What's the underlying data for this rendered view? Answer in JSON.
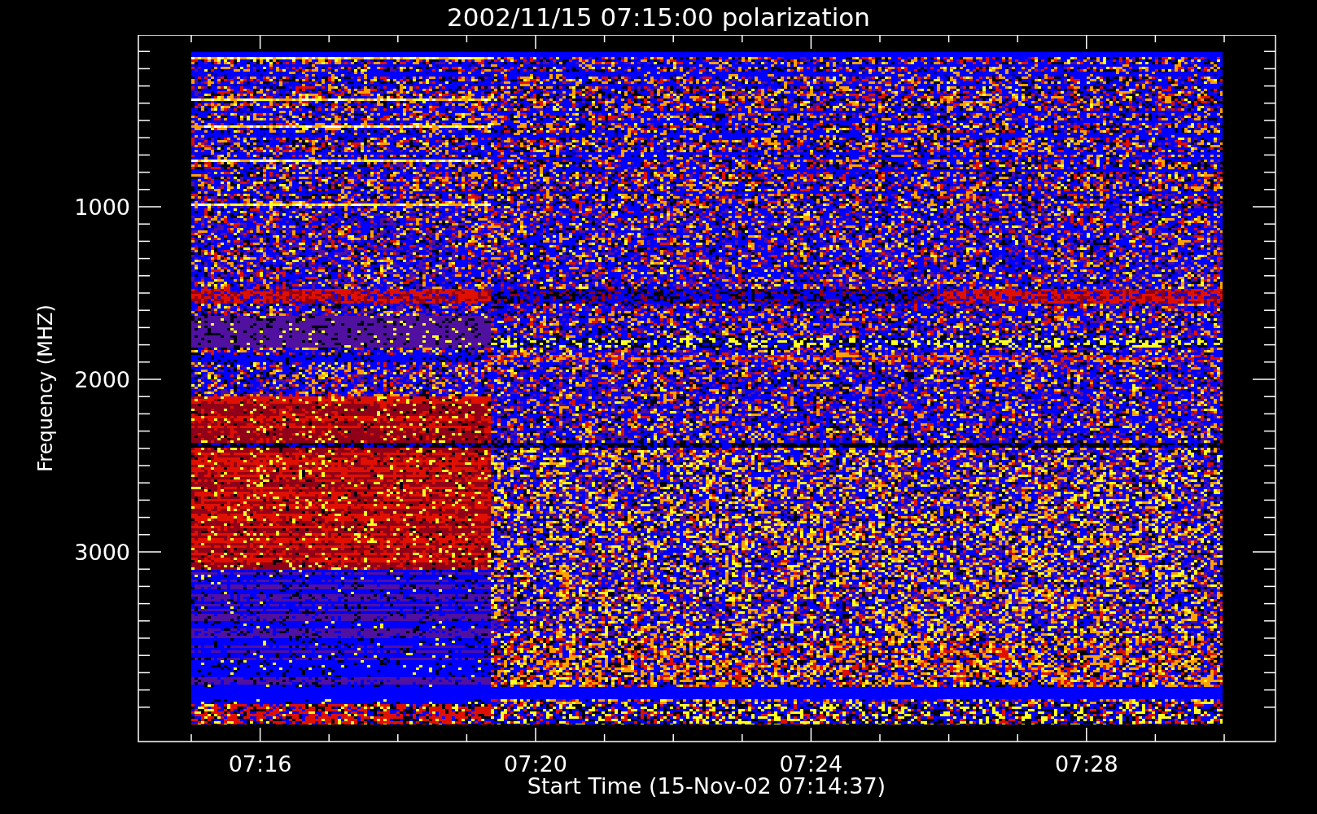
{
  "title": "2002/11/15 07:15:00 polarization",
  "y_axis": {
    "label": "Frequency (MHZ)",
    "ticks": [
      "1000",
      "2000",
      "3000"
    ]
  },
  "x_axis": {
    "label": "Start Time (15-Nov-02 07:14:37)",
    "ticks": [
      "07:16",
      "07:20",
      "07:24",
      "07:28"
    ]
  }
}
